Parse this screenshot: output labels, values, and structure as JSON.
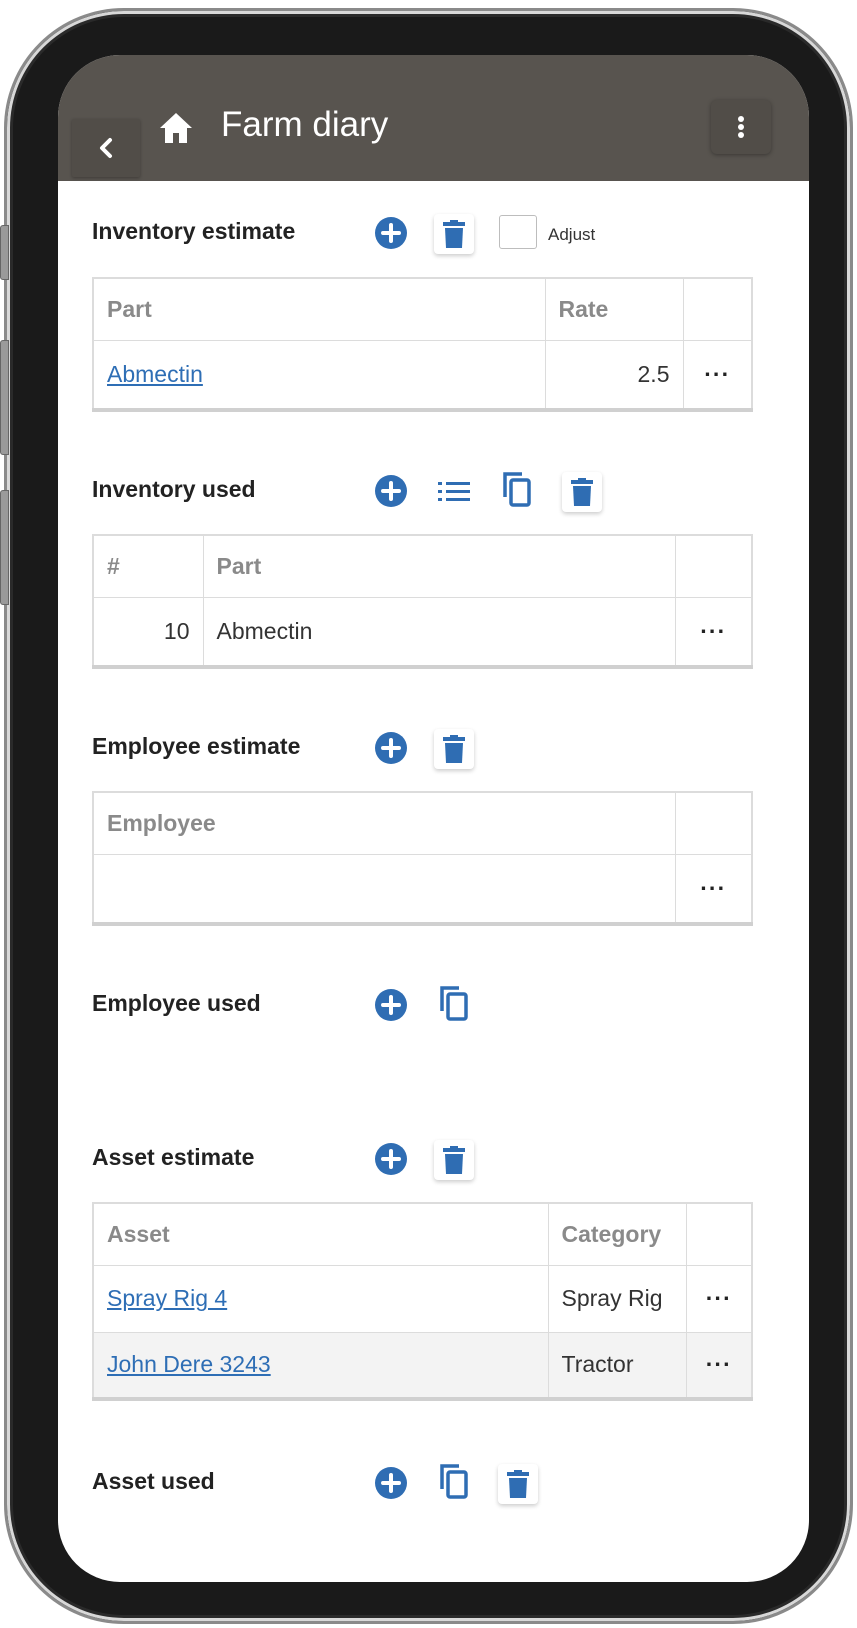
{
  "app": {
    "title": "Farm diary"
  },
  "sections": {
    "inventory_estimate": {
      "title": "Inventory estimate",
      "adjust_label": "Adjust",
      "columns": [
        "Part",
        "Rate",
        ""
      ],
      "rows": [
        {
          "part": "Abmectin",
          "rate": "2.5",
          "more": "···"
        }
      ]
    },
    "inventory_used": {
      "title": "Inventory used",
      "columns": [
        "#",
        "Part",
        ""
      ],
      "rows": [
        {
          "num": "10",
          "part": "Abmectin",
          "more": "···"
        }
      ]
    },
    "employee_estimate": {
      "title": "Employee estimate",
      "columns": [
        "Employee",
        ""
      ],
      "rows": [
        {
          "employee": "",
          "more": "···"
        }
      ]
    },
    "employee_used": {
      "title": "Employee used"
    },
    "asset_estimate": {
      "title": "Asset estimate",
      "columns": [
        "Asset",
        "Category",
        ""
      ],
      "rows": [
        {
          "asset": "Spray Rig 4",
          "category": "Spray Rig",
          "more": "···"
        },
        {
          "asset": "John Dere 3243",
          "category": "Tractor",
          "more": "···"
        }
      ]
    },
    "asset_used": {
      "title": "Asset used"
    }
  },
  "colors": {
    "appbar": "#58544f",
    "accent": "#2e6eb5",
    "icon_blue": "#2f6db3"
  },
  "icons": [
    "back-chevron-icon",
    "home-icon",
    "more-vertical-icon",
    "add-circle-icon",
    "delete-icon",
    "list-icon",
    "copy-icon"
  ]
}
